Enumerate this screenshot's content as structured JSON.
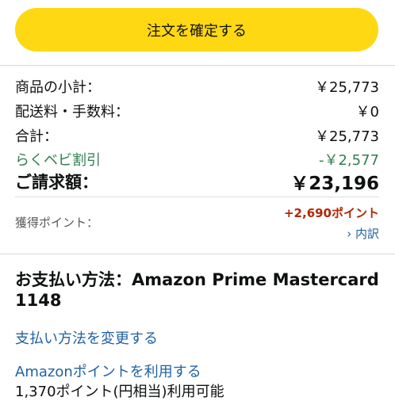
{
  "confirm_button": {
    "label": "注文を確定する",
    "color": "#ffd814"
  },
  "summary": {
    "rows": [
      {
        "label": "商品の小計：",
        "value": "￥25,773"
      },
      {
        "label": "配送料・手数料：",
        "value": "￥0"
      },
      {
        "label": "合計：",
        "value": "￥25,773"
      },
      {
        "label": "らくベビ割引",
        "value": "-￥2,577"
      }
    ],
    "total": {
      "label": "ご請求額：",
      "value": "￥23,196"
    },
    "points": {
      "label": "獲得ポイント：",
      "value": "+2,690ポイント",
      "breakdown_link": "› 内訳"
    }
  },
  "payment": {
    "title": "お支払い方法：Amazon Prime Mastercard 1148",
    "change_link": "支払い方法を変更する",
    "use_points_link": "Amazonポイントを利用する",
    "available_text": "1,370ポイント(円相当)利用可能"
  },
  "colors": {
    "discount": "#2f8050",
    "points": "#b12704",
    "link": "#2162a1"
  }
}
